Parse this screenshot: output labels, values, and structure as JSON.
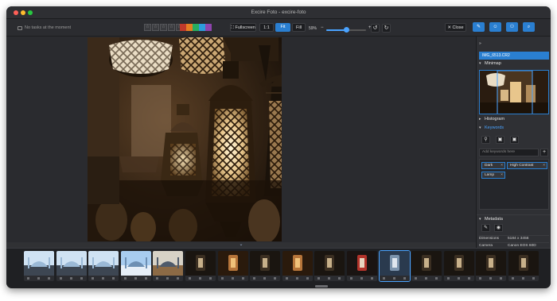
{
  "window": {
    "title": "Excire Foto - excire-foto"
  },
  "toolbar": {
    "tasks_text": "No tasks at the moment",
    "rating": {
      "stars": 5,
      "filled": 0
    },
    "color_labels": [
      "#c0392b",
      "#e67e22",
      "#27ae60",
      "#2d9cdb",
      "#8e44ad"
    ],
    "fullscreen_label": "Fullscreen",
    "one_to_one_label": "1:1",
    "fit_label": "Fit",
    "fill_label": "Fill",
    "zoom_percent": "59%",
    "zoom_level": 0.5,
    "close_label": "Close"
  },
  "panel": {
    "tab_icons": [
      "edit-icon",
      "face-icon",
      "people-icon",
      "search-icon"
    ],
    "file_name": "IMG_6513.CR2",
    "minimap_label": "Minimap",
    "histogram_label": "Histogram",
    "keywords_label": "Keywords",
    "keyword_placeholder": "Add keywords here",
    "keywords": [
      "Dark",
      "High Contrast",
      "Lamp"
    ],
    "metadata_label": "Metadata",
    "metadata": [
      {
        "key": "Dimensions",
        "value": "5184 x 3456"
      },
      {
        "key": "Camera",
        "value": "Canon EOS 60D"
      }
    ]
  },
  "filmstrip": {
    "selected_index": 11,
    "thumbnails": [
      {
        "kind": "mosque"
      },
      {
        "kind": "mosque"
      },
      {
        "kind": "mosque"
      },
      {
        "kind": "mosque-day"
      },
      {
        "kind": "street"
      },
      {
        "kind": "lamp"
      },
      {
        "kind": "lamp-warm"
      },
      {
        "kind": "lamp"
      },
      {
        "kind": "lamp-warm"
      },
      {
        "kind": "lamp"
      },
      {
        "kind": "lamp-red"
      },
      {
        "kind": "lamp-blue"
      },
      {
        "kind": "lamp"
      },
      {
        "kind": "lamp"
      },
      {
        "kind": "lamp"
      },
      {
        "kind": "lamp"
      }
    ]
  }
}
